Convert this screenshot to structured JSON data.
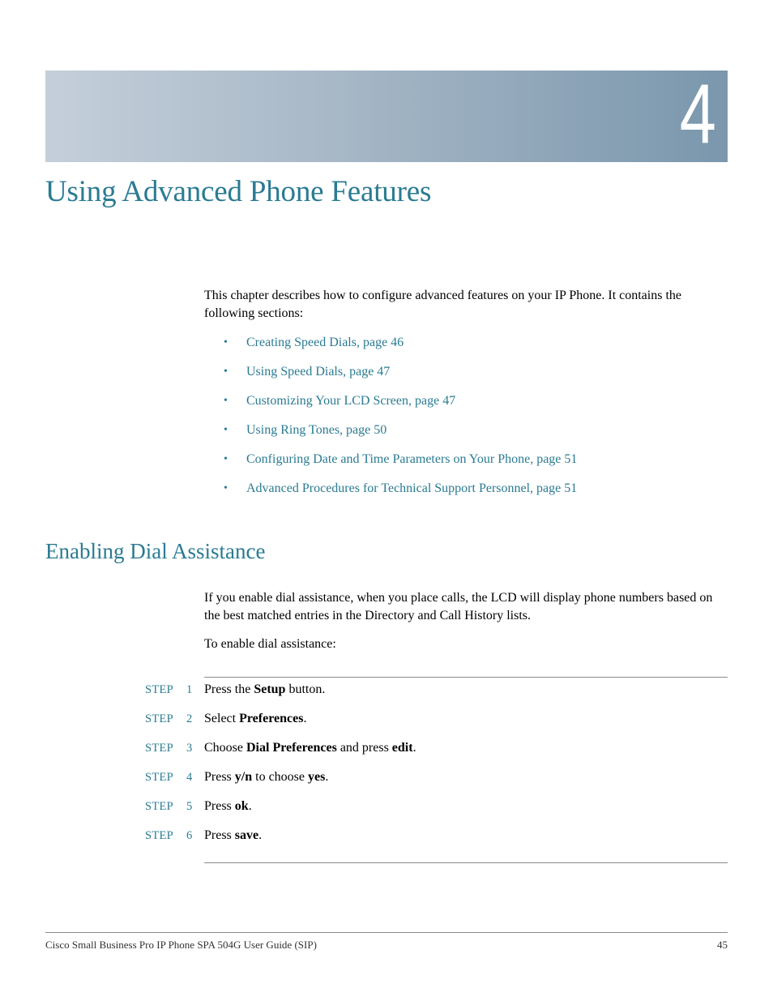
{
  "chapter": {
    "number": "4",
    "title": "Using Advanced Phone Features"
  },
  "intro": {
    "text": "This chapter describes how to configure advanced features on your IP Phone. It contains the following sections:",
    "sections": [
      {
        "bullet": "•",
        "label": "Creating Speed Dials, page 46"
      },
      {
        "bullet": "•",
        "label": "Using Speed Dials, page 47"
      },
      {
        "bullet": "•",
        "label": "Customizing Your LCD Screen, page 47"
      },
      {
        "bullet": "•",
        "label": "Using Ring Tones, page 50"
      },
      {
        "bullet": "•",
        "label": "Configuring Date and Time Parameters on Your Phone, page 51"
      },
      {
        "bullet": "•",
        "label": "Advanced Procedures for Technical Support Personnel, page 51"
      }
    ]
  },
  "section": {
    "heading": "Enabling Dial Assistance",
    "paragraph": "If you enable dial assistance, when you place calls, the LCD will display phone numbers based on the best matched entries in the Directory and Call History lists.",
    "lead_in": "To enable dial assistance:",
    "steps": [
      {
        "label": "STEP",
        "number": "1",
        "parts": [
          {
            "t": "Press the "
          },
          {
            "b": "Setup"
          },
          {
            "t": " button."
          }
        ]
      },
      {
        "label": "STEP",
        "number": "2",
        "parts": [
          {
            "t": "Select "
          },
          {
            "b": "Preferences"
          },
          {
            "t": "."
          }
        ]
      },
      {
        "label": "STEP",
        "number": "3",
        "parts": [
          {
            "t": "Choose "
          },
          {
            "b": "Dial Preferences"
          },
          {
            "t": " and press "
          },
          {
            "b": "edit"
          },
          {
            "t": "."
          }
        ]
      },
      {
        "label": "STEP",
        "number": "4",
        "parts": [
          {
            "t": "Press "
          },
          {
            "b": "y/n"
          },
          {
            "t": " to choose "
          },
          {
            "b": "yes"
          },
          {
            "t": "."
          }
        ]
      },
      {
        "label": "STEP",
        "number": "5",
        "parts": [
          {
            "t": "Press "
          },
          {
            "b": "ok"
          },
          {
            "t": "."
          }
        ]
      },
      {
        "label": "STEP",
        "number": "6",
        "parts": [
          {
            "t": "Press "
          },
          {
            "b": "save"
          },
          {
            "t": "."
          }
        ]
      }
    ]
  },
  "footer": {
    "document_title": "Cisco Small Business Pro IP Phone SPA 504G User Guide (SIP)",
    "page_number": "45"
  },
  "colors": {
    "accent": "#2a7b92",
    "banner_start": "#c4cfda",
    "banner_end": "#7a97ad",
    "rule": "#8a8a8a"
  }
}
